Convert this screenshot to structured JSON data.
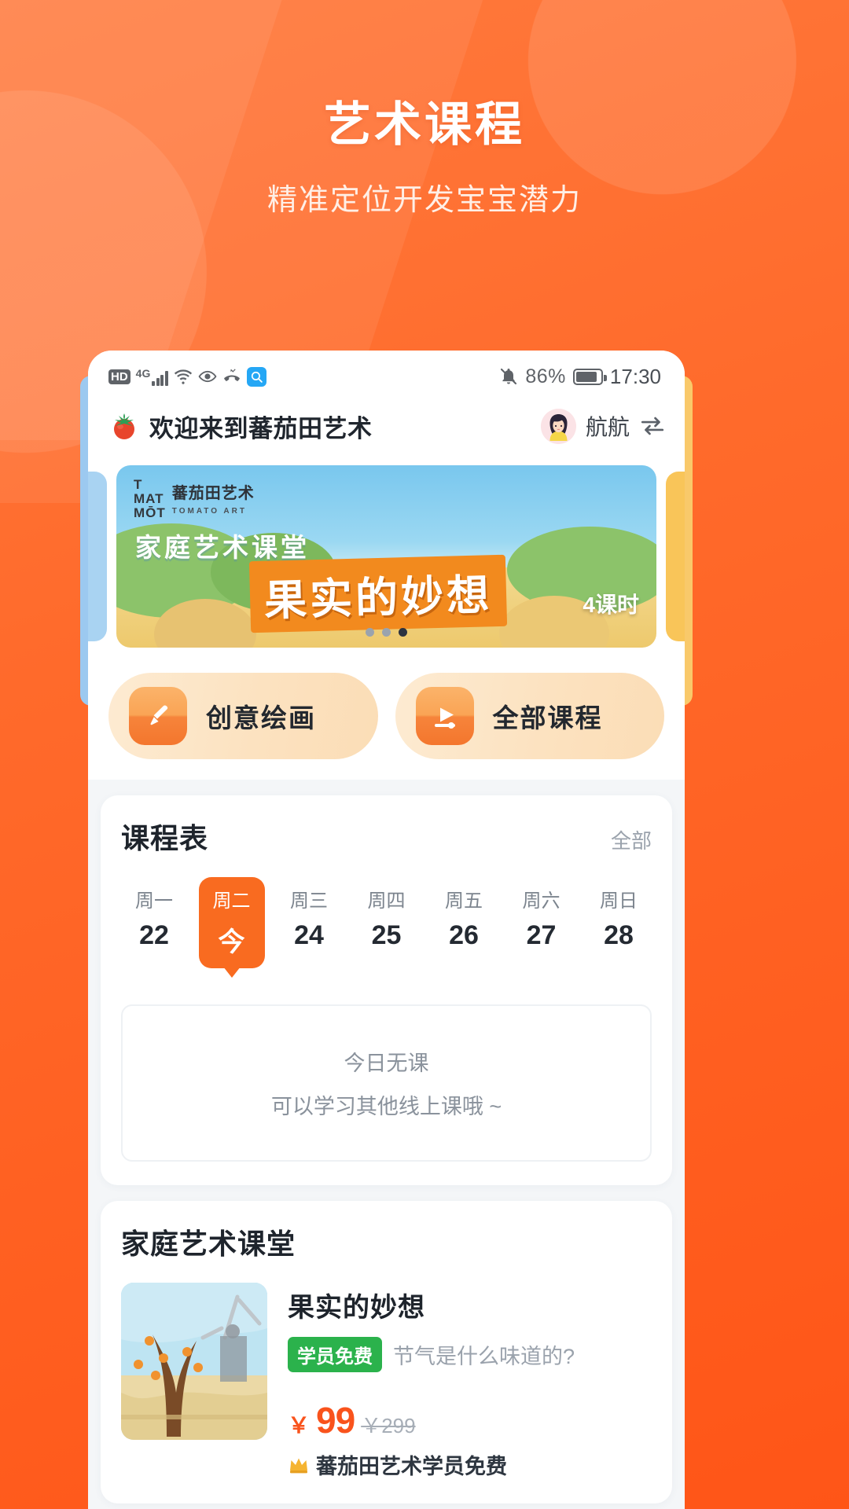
{
  "promo": {
    "title": "艺术课程",
    "subtitle": "精准定位开发宝宝潜力"
  },
  "statusbar": {
    "hd": "HD",
    "network": "4G",
    "battery_pct": "86%",
    "clock": "17:30",
    "icons": [
      "hd-icon",
      "signal-4g-icon",
      "wifi-icon",
      "eye-icon",
      "missed-call-icon",
      "search-icon",
      "mute-bell-icon",
      "battery-icon"
    ]
  },
  "appbar": {
    "title": "欢迎来到蕃茄田艺术",
    "tomato_icon": "tomato-icon",
    "user_name": "航航",
    "switch_icon": "switch-account-icon"
  },
  "banner": {
    "brand_cn": "蕃茄田艺术",
    "brand_en": "TOMATO ART",
    "brand_mark_line1": "T",
    "brand_mark_line2": "MAT",
    "brand_mark_line3": "MŌT",
    "kicker": "家庭艺术课堂",
    "title": "果实的妙想",
    "lessons": "4课时",
    "dots_total": 3,
    "dots_active_index": 2
  },
  "quick_actions": [
    {
      "label": "创意绘画",
      "icon": "paintbrush-icon"
    },
    {
      "label": "全部课程",
      "icon": "play-video-icon"
    }
  ],
  "schedule": {
    "title": "课程表",
    "more_label": "全部",
    "days": [
      {
        "weekday": "周一",
        "date": "22",
        "active": false
      },
      {
        "weekday": "周二",
        "date": "今",
        "active": true
      },
      {
        "weekday": "周三",
        "date": "24",
        "active": false
      },
      {
        "weekday": "周四",
        "date": "25",
        "active": false
      },
      {
        "weekday": "周五",
        "date": "26",
        "active": false
      },
      {
        "weekday": "周六",
        "date": "27",
        "active": false
      },
      {
        "weekday": "周日",
        "date": "28",
        "active": false
      }
    ],
    "empty_line1": "今日无课",
    "empty_line2": "可以学习其他线上课哦 ~"
  },
  "course_list": {
    "title": "家庭艺术课堂",
    "items": [
      {
        "name": "果实的妙想",
        "badge": "学员免费",
        "subtitle": "节气是什么味道的?",
        "currency": "￥",
        "price": "99",
        "original_price": "￥299",
        "note": "蕃茄田艺术学员免费",
        "note_icon": "crown-icon"
      }
    ]
  },
  "colors": {
    "brand_orange": "#FF5A1F",
    "accent_orange": "#F96B20",
    "price_red": "#F9531C",
    "badge_green": "#2BB24C",
    "text_dark": "#1E242C",
    "text_muted": "#9AA2AC"
  }
}
